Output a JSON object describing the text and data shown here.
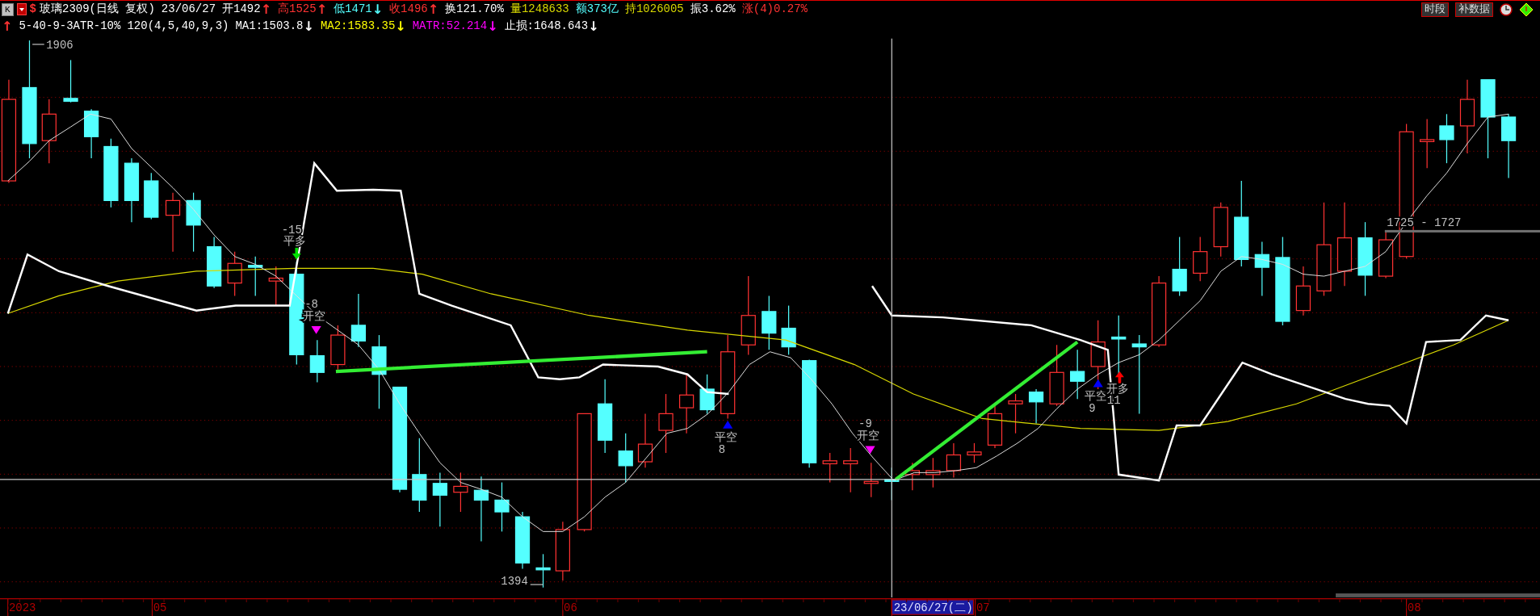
{
  "toolbar": {
    "period_key": "K",
    "symbol_mark": "$"
  },
  "quote": [
    {
      "kind": "value",
      "text": "玻璃2309(日线 复权)",
      "color": "#ffffff"
    },
    {
      "kind": "value",
      "text": "23/06/27",
      "color": "#ffffff"
    },
    {
      "kind": "value",
      "text": "开1492",
      "color": "#ffffff"
    },
    {
      "kind": "arrow",
      "text": "↑",
      "color": "#ff3232"
    },
    {
      "kind": "value",
      "text": "高1525",
      "color": "#ff3232"
    },
    {
      "kind": "arrow",
      "text": "↑",
      "color": "#ff3232"
    },
    {
      "kind": "value",
      "text": "低1471",
      "color": "#54ffff"
    },
    {
      "kind": "arrow",
      "text": "↓",
      "color": "#54ffff"
    },
    {
      "kind": "value",
      "text": "收1496",
      "color": "#ff3232"
    },
    {
      "kind": "arrow",
      "text": "↑",
      "color": "#ff3232"
    },
    {
      "kind": "value",
      "text": "换121.70%",
      "color": "#ffffff"
    },
    {
      "kind": "value",
      "text": "量1248633",
      "color": "#d8d800"
    },
    {
      "kind": "value",
      "text": "额373亿",
      "color": "#54ffff"
    },
    {
      "kind": "value",
      "text": "持1026005",
      "color": "#d8d800"
    },
    {
      "kind": "value",
      "text": "振3.62%",
      "color": "#ffffff"
    },
    {
      "kind": "value",
      "text": "涨(4)0.27%",
      "color": "#ff3232"
    }
  ],
  "buttons": [
    "时段",
    "补数据"
  ],
  "indicator": [
    {
      "kind": "arrow",
      "text": "↑",
      "color": "#ff3232"
    },
    {
      "kind": "value",
      "text": "5-40-9-3ATR-10%",
      "color": "#ffffff"
    },
    {
      "kind": "value",
      "text": "120(4,5,40,9,3)",
      "color": "#ffffff"
    },
    {
      "kind": "value",
      "text": "MA1:1503.8",
      "color": "#ffffff"
    },
    {
      "kind": "arrow",
      "text": "↓",
      "color": "#ffffff"
    },
    {
      "kind": "value",
      "text": "MA2:1583.35",
      "color": "#ffff00"
    },
    {
      "kind": "arrow",
      "text": "↓",
      "color": "#ffff00"
    },
    {
      "kind": "value",
      "text": "MATR:52.214",
      "color": "#ff00ff"
    },
    {
      "kind": "arrow",
      "text": "↓",
      "color": "#ff00ff"
    },
    {
      "kind": "value",
      "text": "止损:1648.643",
      "color": "#ffffff"
    },
    {
      "kind": "arrow",
      "text": "↓",
      "color": "#ffffff"
    }
  ],
  "chart": {
    "high_label": "1906",
    "low_label": "1394",
    "range_label": "1725 - 1727",
    "signals": [
      {
        "kind": "arrow-down",
        "color": "#00e000",
        "count": "-15",
        "label": "平多"
      },
      {
        "kind": "triangle-down",
        "color": "#ff00ff",
        "count": "-8",
        "label": "开空"
      },
      {
        "kind": "triangle-up",
        "color": "#0000ff",
        "label": "平空",
        "count": "8"
      },
      {
        "kind": "triangle-down",
        "color": "#ff00ff",
        "count": "-9",
        "label": "开空"
      },
      {
        "kind": "triangle-up",
        "color": "#0000ff",
        "label": "平空",
        "count": "9"
      },
      {
        "kind": "arrow-up",
        "color": "#ff0000",
        "label": "开多",
        "count": "11"
      }
    ],
    "axis": [
      {
        "text": "2023",
        "highlighted": false
      },
      {
        "text": "05",
        "highlighted": false
      },
      {
        "text": "06",
        "highlighted": false
      },
      {
        "text": "23/06/27(二)",
        "highlighted": true
      },
      {
        "text": "07",
        "highlighted": false
      },
      {
        "text": "08",
        "highlighted": false
      }
    ]
  }
}
